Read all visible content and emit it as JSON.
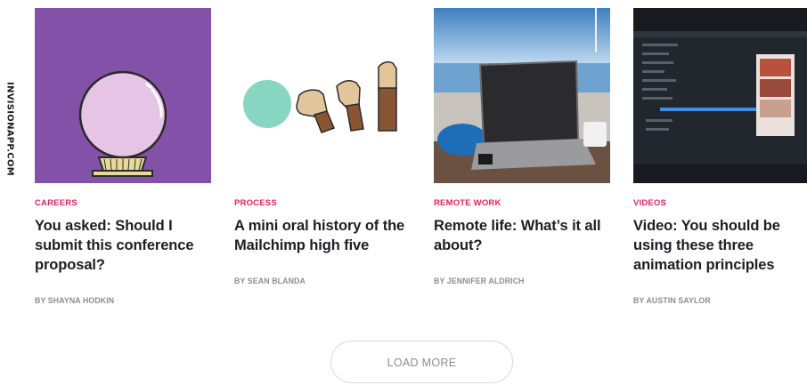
{
  "brand": {
    "vertical_text": "INVISIONAPP.COM"
  },
  "articles": [
    {
      "category": "Careers",
      "title": "You asked: Should I submit this conference proposal?",
      "byline": "By Shayna Hodkin",
      "thumbnail_icon": "crystal-ball-illustration",
      "accent_color": "#8451a8"
    },
    {
      "category": "Process",
      "title": "A mini oral history of the Mailchimp high five",
      "byline": "By Sean Blanda",
      "thumbnail_icon": "high-five-hands-illustration",
      "accent_color": "#7fd4c1"
    },
    {
      "category": "Remote Work",
      "title": "Remote life: What’s it all about?",
      "byline": "By Jennifer Aldrich",
      "thumbnail_icon": "laptop-seaside-photo",
      "accent_color": "#5a8fbd"
    },
    {
      "category": "Videos",
      "title": "Video: You should be using these three animation principles",
      "byline": "By Austin Saylor",
      "thumbnail_icon": "animation-software-screenshot",
      "accent_color": "#1a1d22"
    }
  ],
  "load_more_label": "LOAD MORE",
  "colors": {
    "category": "#e0245e",
    "title": "#1d1d25",
    "byline": "#8d8d93"
  }
}
